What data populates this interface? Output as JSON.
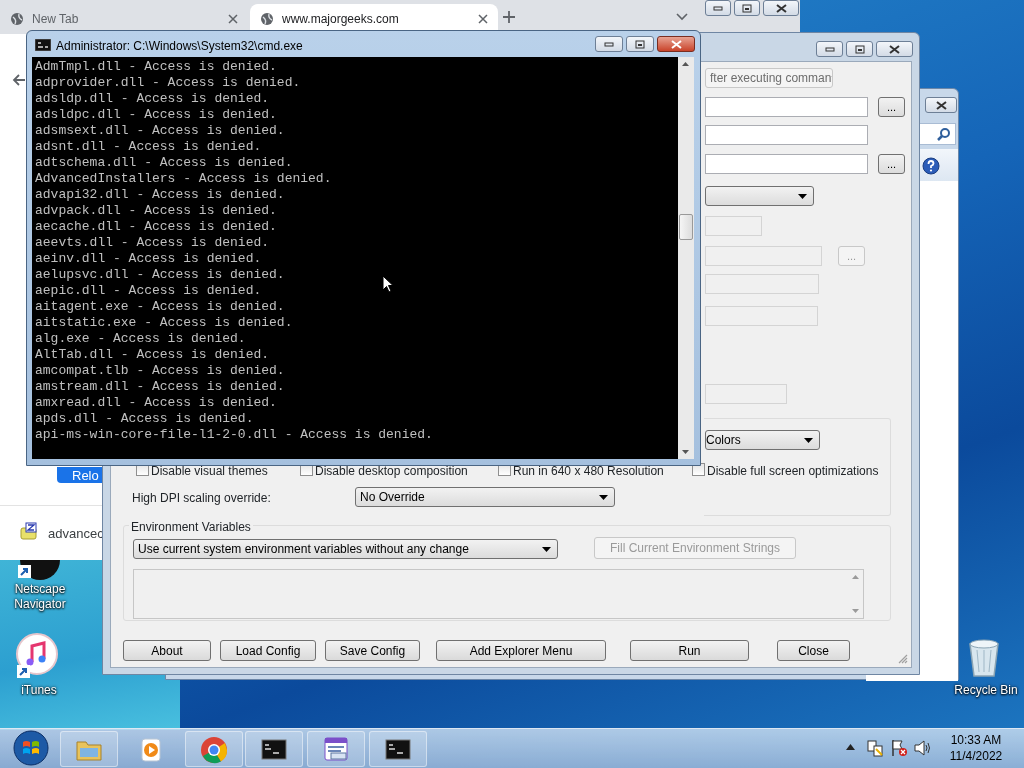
{
  "browser": {
    "tabs": [
      {
        "title": "New Tab",
        "selected": false
      },
      {
        "title": "www.majorgeeks.com",
        "selected": true
      }
    ],
    "reload_button": "Relo",
    "download": "advancec"
  },
  "cmd": {
    "title": "Administrator:  C:\\Windows\\System32\\cmd.exe",
    "lines": [
      "AdmTmpl.dll - Access is denied.",
      "adprovider.dll - Access is denied.",
      "adsldp.dll - Access is denied.",
      "adsldpc.dll - Access is denied.",
      "adsmsext.dll - Access is denied.",
      "adsnt.dll - Access is denied.",
      "adtschema.dll - Access is denied.",
      "AdvancedInstallers - Access is denied.",
      "advapi32.dll - Access is denied.",
      "advpack.dll - Access is denied.",
      "aecache.dll - Access is denied.",
      "aeevts.dll - Access is denied.",
      "aeinv.dll - Access is denied.",
      "aelupsvc.dll - Access is denied.",
      "aepic.dll - Access is denied.",
      "aitagent.exe - Access is denied.",
      "aitstatic.exe - Access is denied.",
      "alg.exe - Access is denied.",
      "AltTab.dll - Access is denied.",
      "amcompat.tlb - Access is denied.",
      "amstream.dll - Access is denied.",
      "amxread.dll - Access is denied.",
      "apds.dll - Access is denied.",
      "api-ms-win-core-file-l1-2-0.dll - Access is denied."
    ]
  },
  "launcher": {
    "fields": [
      {
        "kind": "combo",
        "value": "fter executing comman",
        "disabled": true
      },
      {
        "kind": "text",
        "disabled": false,
        "browse": "..."
      },
      {
        "kind": "text",
        "disabled": false
      },
      {
        "kind": "text",
        "disabled": false,
        "browse": "..."
      },
      {
        "kind": "combo",
        "disabled": false
      },
      {
        "kind": "text",
        "disabled": true
      },
      {
        "kind": "text",
        "disabled": true,
        "browse": "...",
        "browse_disabled": true
      },
      {
        "kind": "text",
        "disabled": true
      },
      {
        "kind": "text",
        "disabled": true
      },
      {
        "kind": "text",
        "disabled": true
      }
    ],
    "colors_value": "Colors",
    "checkboxes": [
      {
        "label": "Disable visual themes",
        "checked": false
      },
      {
        "label": "Disable desktop composition",
        "checked": false
      },
      {
        "label": "Run in 640 x 480 Resolution",
        "checked": false
      },
      {
        "label": "Disable full screen optimizations",
        "checked": false
      }
    ],
    "dpi_label": "High DPI scaling override:",
    "dpi_value": "No Override",
    "env_title": "Environment Variables",
    "env_mode": "Use current system environment variables without any change",
    "fill_button": {
      "label": "Fill Current Environment Strings",
      "disabled": true
    },
    "buttons": [
      "About",
      "Load Config",
      "Save Config",
      "Add Explorer Menu",
      "Run",
      "Close"
    ]
  },
  "desktop_icons": [
    {
      "kind": "browser",
      "label": "Netscape Navigator"
    },
    {
      "kind": "music",
      "label": "iTunes"
    },
    {
      "kind": "trash",
      "label": "Recycle Bin"
    }
  ],
  "taskbar": {
    "time": "10:33 AM",
    "date": "11/4/2022"
  }
}
